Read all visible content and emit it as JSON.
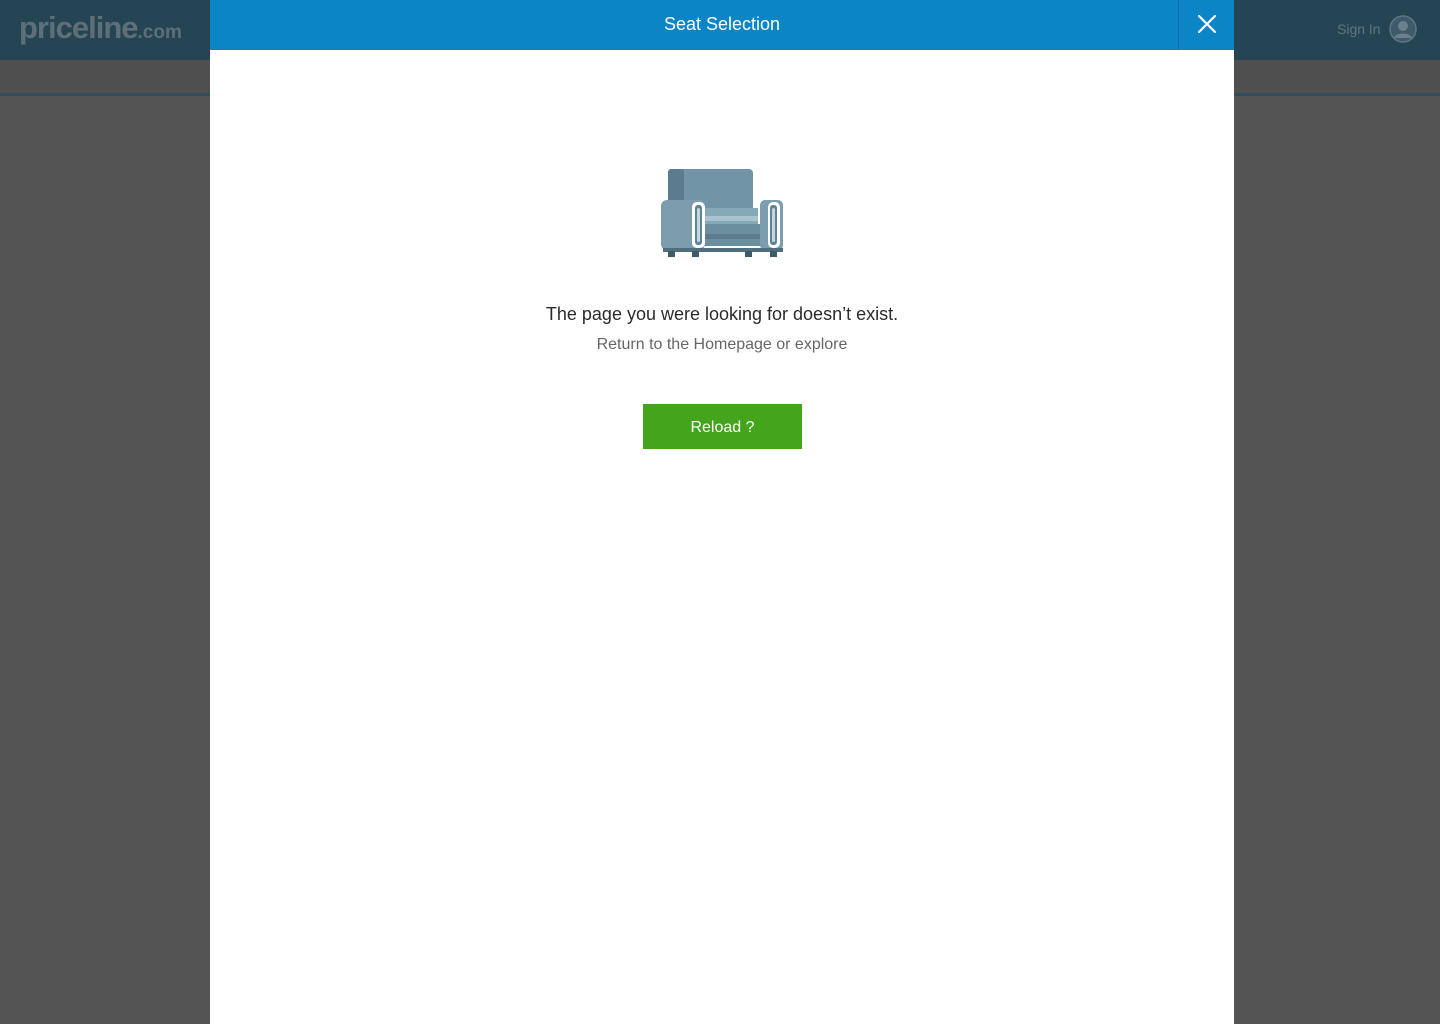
{
  "background": {
    "logo_main": "priceline",
    "logo_suffix": ".com",
    "signin_label": "Sign In",
    "avatar_icon": "user-avatar-icon"
  },
  "modal": {
    "title": "Seat Selection",
    "close_icon": "close-icon",
    "illustration_icon": "armchair-icon",
    "message": "The page you were looking for doesn’t exist.",
    "submessage": "Return to the Homepage or explore",
    "reload_label": "Reload ?"
  },
  "colors": {
    "header_blue": "#0b85c5",
    "button_green": "#44a51c",
    "overlay_gray": "#545454"
  }
}
